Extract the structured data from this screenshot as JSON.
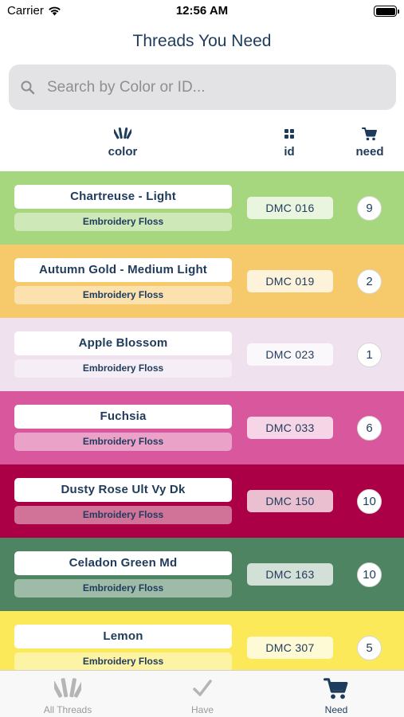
{
  "status_bar": {
    "carrier": "Carrier",
    "time": "12:56 AM"
  },
  "page_title": "Threads You Need",
  "search": {
    "placeholder": "Search by Color or ID..."
  },
  "columns": {
    "color": "color",
    "id": "id",
    "need": "need"
  },
  "threads": [
    {
      "name": "Chartreuse - Light",
      "type": "Embroidery Floss",
      "id": "DMC 016",
      "need": "9",
      "color": "#a6d67e"
    },
    {
      "name": "Autumn Gold - Medium Light",
      "type": "Embroidery Floss",
      "id": "DMC 019",
      "need": "2",
      "color": "#f6c96b"
    },
    {
      "name": "Apple Blossom",
      "type": "Embroidery Floss",
      "id": "DMC 023",
      "need": "1",
      "color": "#efe1ee"
    },
    {
      "name": "Fuchsia",
      "type": "Embroidery Floss",
      "id": "DMC 033",
      "need": "6",
      "color": "#d9579c"
    },
    {
      "name": "Dusty Rose Ult Vy Dk",
      "type": "Embroidery Floss",
      "id": "DMC 150",
      "need": "10",
      "color": "#ac0046"
    },
    {
      "name": "Celadon Green Md",
      "type": "Embroidery Floss",
      "id": "DMC 163",
      "need": "10",
      "color": "#4f8462"
    },
    {
      "name": "Lemon",
      "type": "Embroidery Floss",
      "id": "DMC 307",
      "need": "5",
      "color": "#fbe95a"
    }
  ],
  "tabs": [
    {
      "label": "All Threads",
      "icon": "thread-fan-icon",
      "active": false
    },
    {
      "label": "Have",
      "icon": "checkmark-icon",
      "active": false
    },
    {
      "label": "Need",
      "icon": "cart-icon",
      "active": true
    }
  ],
  "colors": {
    "accent": "#1f3b5c",
    "inactive": "#b0b0b0"
  }
}
